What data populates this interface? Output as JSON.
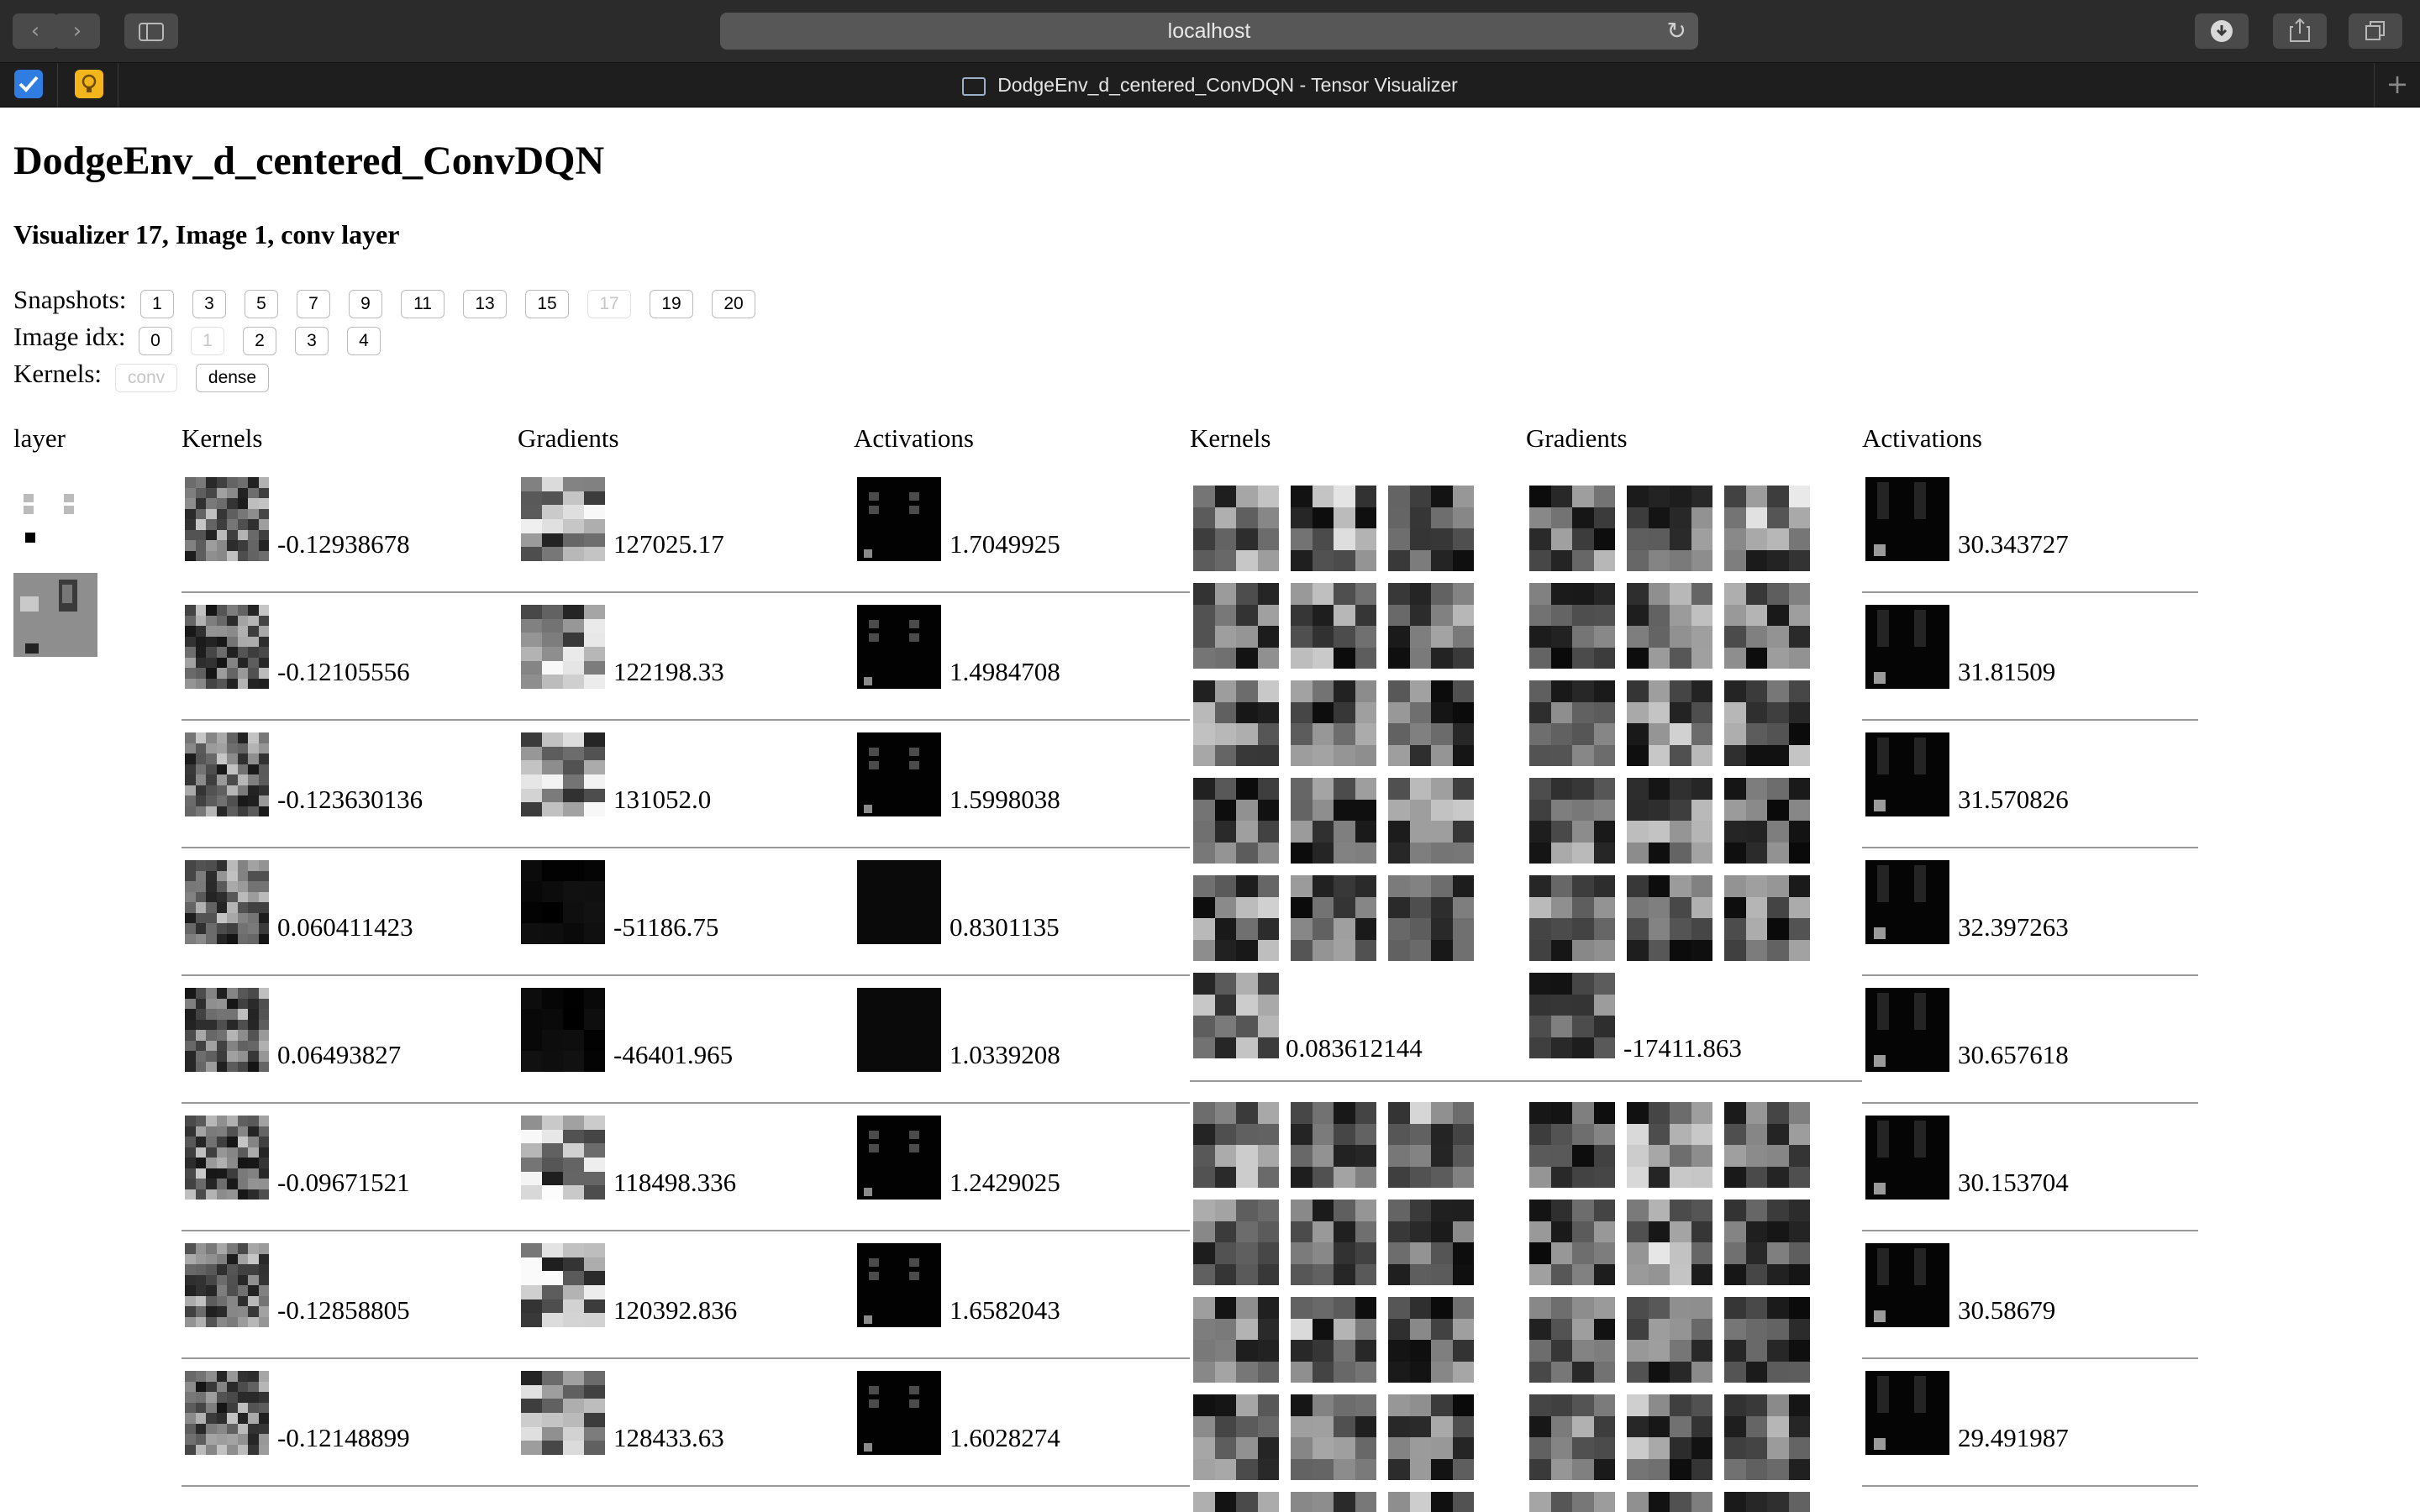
{
  "browser": {
    "url": "localhost",
    "tab_title": "DodgeEnv_d_centered_ConvDQN - Tensor Visualizer"
  },
  "page": {
    "title": "DodgeEnv_d_centered_ConvDQN",
    "subtitle": "Visualizer 17, Image 1, conv layer",
    "snapshots_label": "Snapshots:",
    "snapshots": [
      {
        "label": "1",
        "disabled": false
      },
      {
        "label": "3",
        "disabled": false
      },
      {
        "label": "5",
        "disabled": false
      },
      {
        "label": "7",
        "disabled": false
      },
      {
        "label": "9",
        "disabled": false
      },
      {
        "label": "11",
        "disabled": false
      },
      {
        "label": "13",
        "disabled": false
      },
      {
        "label": "15",
        "disabled": false
      },
      {
        "label": "17",
        "disabled": true
      },
      {
        "label": "19",
        "disabled": false
      },
      {
        "label": "20",
        "disabled": false
      }
    ],
    "image_idx_label": "Image idx:",
    "image_idx": [
      {
        "label": "0",
        "disabled": false
      },
      {
        "label": "1",
        "disabled": true
      },
      {
        "label": "2",
        "disabled": false
      },
      {
        "label": "3",
        "disabled": false
      },
      {
        "label": "4",
        "disabled": false
      }
    ],
    "kernels_label": "Kernels:",
    "kernel_modes": [
      {
        "label": "conv",
        "disabled": true
      },
      {
        "label": "dense",
        "disabled": false
      }
    ]
  },
  "columns": {
    "layer": "layer",
    "conv_kernels": "Kernels",
    "conv_gradients": "Gradients",
    "conv_activations": "Activations",
    "dense_kernels": "Kernels",
    "dense_gradients": "Gradients",
    "dense_activations": "Activations"
  },
  "conv_rows": [
    {
      "kernel": "-0.12938678",
      "gradient": "127025.17",
      "activation": "1.7049925"
    },
    {
      "kernel": "-0.12105556",
      "gradient": "122198.33",
      "activation": "1.4984708"
    },
    {
      "kernel": "-0.123630136",
      "gradient": "131052.0",
      "activation": "1.5998038"
    },
    {
      "kernel": "0.060411423",
      "gradient": "-51186.75",
      "activation": "0.8301135"
    },
    {
      "kernel": "0.06493827",
      "gradient": "-46401.965",
      "activation": "1.0339208"
    },
    {
      "kernel": "-0.09671521",
      "gradient": "118498.336",
      "activation": "1.2429025"
    },
    {
      "kernel": "-0.12858805",
      "gradient": "120392.836",
      "activation": "1.6582043"
    },
    {
      "kernel": "-0.12148899",
      "gradient": "128433.63",
      "activation": "1.6028274"
    }
  ],
  "dense_groups": [
    {
      "kernel": "0.083612144",
      "gradient": "-17411.863"
    }
  ],
  "dense_activations": [
    "30.343727",
    "31.81509",
    "31.570826",
    "32.397263",
    "30.657618",
    "30.153704",
    "30.58679",
    "29.491987"
  ],
  "colors": {
    "chrome": "#2b2b2b",
    "tabstrip": "#1e1e1e",
    "separator": "#999999",
    "favicon_mail": "#2f7de1",
    "favicon_bulb": "#f2b51c"
  }
}
